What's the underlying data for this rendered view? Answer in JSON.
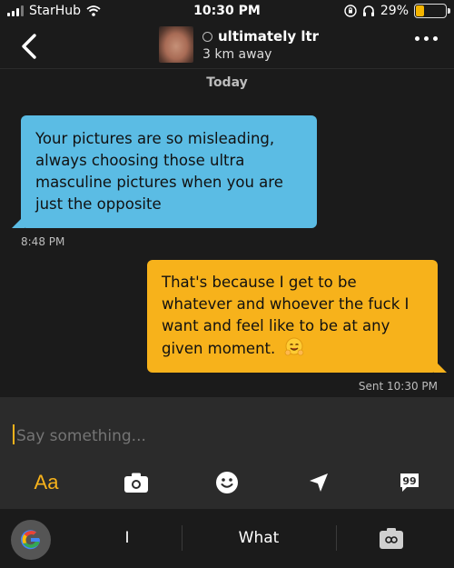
{
  "status_bar": {
    "carrier": "StarHub",
    "time": "10:30 PM",
    "battery_percent": "29%",
    "battery_level": 0.29
  },
  "header": {
    "profile_name": "ultimately ltr",
    "distance": "3 km away",
    "back_icon": "chevron-left-icon",
    "more_icon": "ellipsis-icon"
  },
  "conversation": {
    "day_label": "Today",
    "messages": [
      {
        "direction": "incoming",
        "lines": [
          "Your pictures are so misleading,",
          "always choosing those ultra",
          "masculine pictures when you are",
          "just the opposite"
        ],
        "time": "8:48 PM"
      },
      {
        "direction": "outgoing",
        "lines": [
          "That's because I get to be",
          "whatever and whoever the fuck I",
          "want and feel like to be at any",
          "given moment."
        ],
        "emoji": "hugging-face-icon",
        "time": "Sent 10:30 PM"
      }
    ]
  },
  "compose": {
    "placeholder": "Say something...",
    "format_label": "Aa"
  },
  "keyboard": {
    "suggestions": [
      "I",
      "What"
    ]
  },
  "colors": {
    "incoming_bubble": "#5bbce4",
    "outgoing_bubble": "#f7b21b",
    "background": "#1b1b1b",
    "compose_background": "#2b2b2b"
  }
}
